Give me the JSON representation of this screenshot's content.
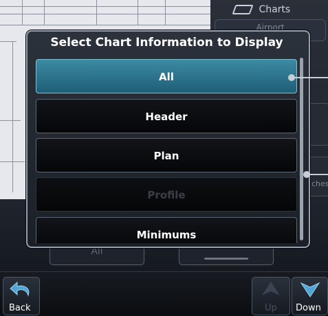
{
  "right_panel": {
    "title": "Charts",
    "tab": "Airport",
    "partial_label": "ches"
  },
  "under_buttons": {
    "all_label": "All"
  },
  "dialog": {
    "title": "Select Chart Information to Display",
    "options": [
      {
        "label": "All",
        "state": "selected"
      },
      {
        "label": "Header",
        "state": "enabled"
      },
      {
        "label": "Plan",
        "state": "enabled"
      },
      {
        "label": "Profile",
        "state": "disabled"
      },
      {
        "label": "Minimums",
        "state": "enabled"
      }
    ]
  },
  "bottom_bar": {
    "back_label": "Back",
    "up_label": "Up",
    "down_label": "Down"
  },
  "colors": {
    "selected_option": "#2f7f9a",
    "accent_arrow": "#4fa6d6"
  }
}
